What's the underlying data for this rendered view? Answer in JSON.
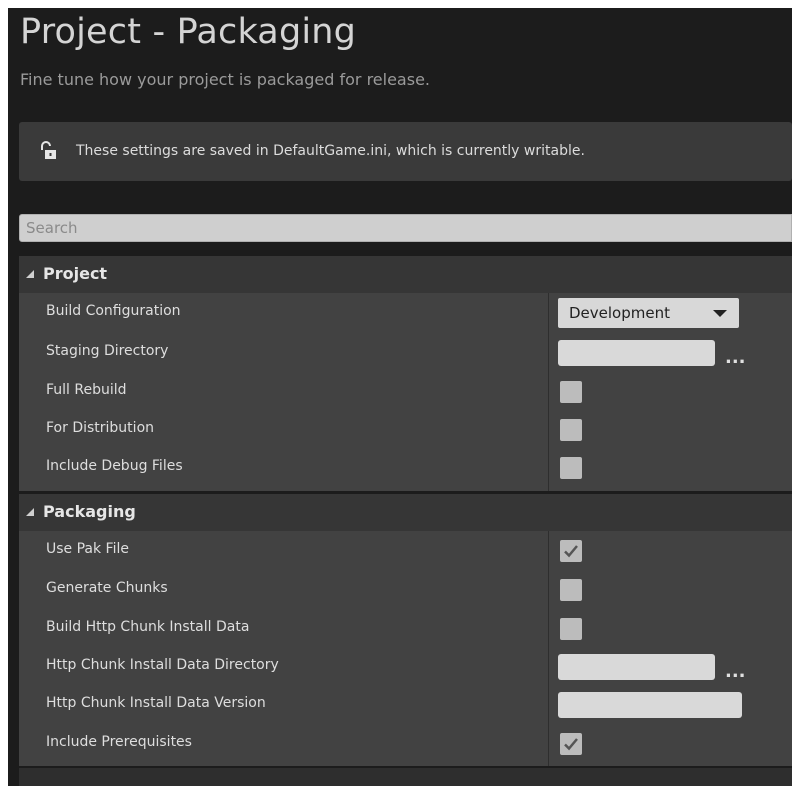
{
  "header": {
    "title": "Project - Packaging",
    "subtitle": "Fine tune how your project is packaged for release."
  },
  "notice": {
    "icon": "unlocked-padlock-icon",
    "text": "These settings are saved in DefaultGame.ini, which is currently writable."
  },
  "search": {
    "placeholder": "Search",
    "value": ""
  },
  "sections": {
    "project": {
      "label": "Project",
      "build_configuration": {
        "label": "Build Configuration",
        "value": "Development"
      },
      "staging_directory": {
        "label": "Staging Directory",
        "value": "",
        "browse": "..."
      },
      "full_rebuild": {
        "label": "Full Rebuild",
        "checked": false
      },
      "for_distribution": {
        "label": "For Distribution",
        "checked": false
      },
      "include_debug_files": {
        "label": "Include Debug Files",
        "checked": false
      }
    },
    "packaging": {
      "label": "Packaging",
      "use_pak_file": {
        "label": "Use Pak File",
        "checked": true
      },
      "generate_chunks": {
        "label": "Generate Chunks",
        "checked": false
      },
      "build_http_chunk": {
        "label": "Build Http Chunk Install Data",
        "checked": false
      },
      "http_chunk_directory": {
        "label": "Http Chunk Install Data Directory",
        "value": "",
        "browse": "..."
      },
      "http_chunk_version": {
        "label": "Http Chunk Install Data Version",
        "value": ""
      },
      "include_prerequisites": {
        "label": "Include Prerequisites",
        "checked": true
      }
    }
  },
  "colors": {
    "background": "#1c1c1c",
    "category": "#363636",
    "row": "#424242",
    "field": "#d9d9d9",
    "text": "#dedede"
  }
}
